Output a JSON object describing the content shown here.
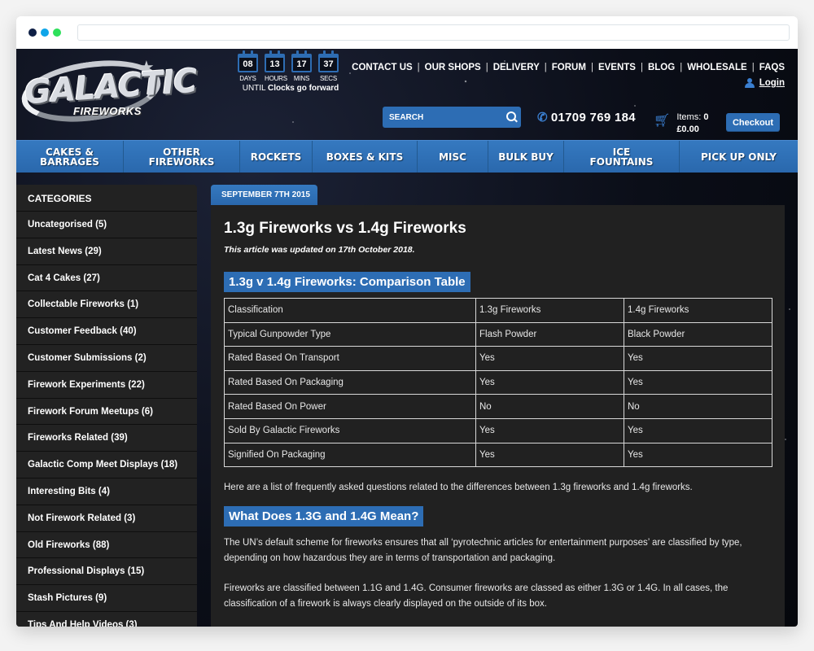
{
  "browser": {
    "url": ""
  },
  "header": {
    "logo": {
      "main": "GALACTIC",
      "sub": "FIREWORKS"
    },
    "countdown": {
      "units": [
        {
          "value": "08",
          "label": "DAYS"
        },
        {
          "value": "13",
          "label": "HOURS"
        },
        {
          "value": "17",
          "label": "MINS"
        },
        {
          "value": "37",
          "label": "SECS"
        }
      ],
      "until_prefix": "UNTIL",
      "until_event": "Clocks go forward"
    },
    "top_links": [
      "CONTACT US",
      "OUR SHOPS",
      "DELIVERY",
      "FORUM",
      "EVENTS",
      "BLOG",
      "WHOLESALE",
      "FAQS"
    ],
    "login_label": "Login",
    "search_placeholder": "SEARCH",
    "phone": "01709 769 184",
    "cart": {
      "items_label": "Items:",
      "items_count": "0",
      "total": "£0.00"
    },
    "checkout_label": "Checkout"
  },
  "main_nav": [
    {
      "line1": "CAKES &",
      "line2": "BARRAGES"
    },
    {
      "line1": "OTHER",
      "line2": "FIREWORKS"
    },
    {
      "line1": "ROCKETS",
      "line2": ""
    },
    {
      "line1": "BOXES & KITS",
      "line2": ""
    },
    {
      "line1": "MISC",
      "line2": ""
    },
    {
      "line1": "BULK BUY",
      "line2": ""
    },
    {
      "line1": "ICE",
      "line2": "FOUNTAINS"
    },
    {
      "line1": "PICK UP ONLY",
      "line2": ""
    }
  ],
  "sidebar": {
    "title": "CATEGORIES",
    "items": [
      "Uncategorised (5)",
      "Latest News (29)",
      "Cat 4 Cakes (27)",
      "Collectable Fireworks (1)",
      "Customer Feedback (40)",
      "Customer Submissions (2)",
      "Firework Experiments (22)",
      "Firework Forum Meetups (6)",
      "Fireworks Related (39)",
      "Galactic Comp Meet Displays (18)",
      "Interesting Bits (4)",
      "Not Firework Related (3)",
      "Old Fireworks (88)",
      "Professional Displays (15)",
      "Stash Pictures (9)",
      "Tips And Help Videos (3)"
    ]
  },
  "article": {
    "date": "SEPTEMBER 7TH 2015",
    "title": "1.3g Fireworks vs 1.4g Fireworks",
    "updated": "This article was updated on 17th October 2018.",
    "table_heading": "1.3g v 1.4g Fireworks: Comparison Table",
    "table": [
      [
        "Classification",
        "1.3g Fireworks",
        "1.4g Fireworks"
      ],
      [
        "Typical Gunpowder Type",
        "Flash Powder",
        "Black Powder"
      ],
      [
        "Rated Based On Transport",
        "Yes",
        "Yes"
      ],
      [
        "Rated Based On Packaging",
        "Yes",
        "Yes"
      ],
      [
        "Rated Based On Power",
        "No",
        "No"
      ],
      [
        "Sold By Galactic Fireworks",
        "Yes",
        "Yes"
      ],
      [
        "Signified On Packaging",
        "Yes",
        "Yes"
      ]
    ],
    "intro": "Here are a list of frequently asked questions related to the differences between 1.3g fireworks and 1.4g fireworks.",
    "faq_heading": "What Does 1.3G and 1.4G Mean?",
    "paragraphs": [
      "The UN’s default scheme for fireworks ensures that all ‘pyrotechnic articles for entertainment purposes’ are classified by type, depending on how hazardous they are in terms of transportation and packaging.",
      "Fireworks are classified between 1.1G and 1.4G. Consumer fireworks are classed as either 1.3G or 1.4G. In all cases, the classification of a firework is always clearly displayed on the outside of its box."
    ]
  },
  "colors": {
    "brand_blue": "#2d6db4",
    "panel_bg": "#212121",
    "window_dots": [
      "#0e1f45",
      "#0ea5e9",
      "#2ee05b"
    ]
  }
}
